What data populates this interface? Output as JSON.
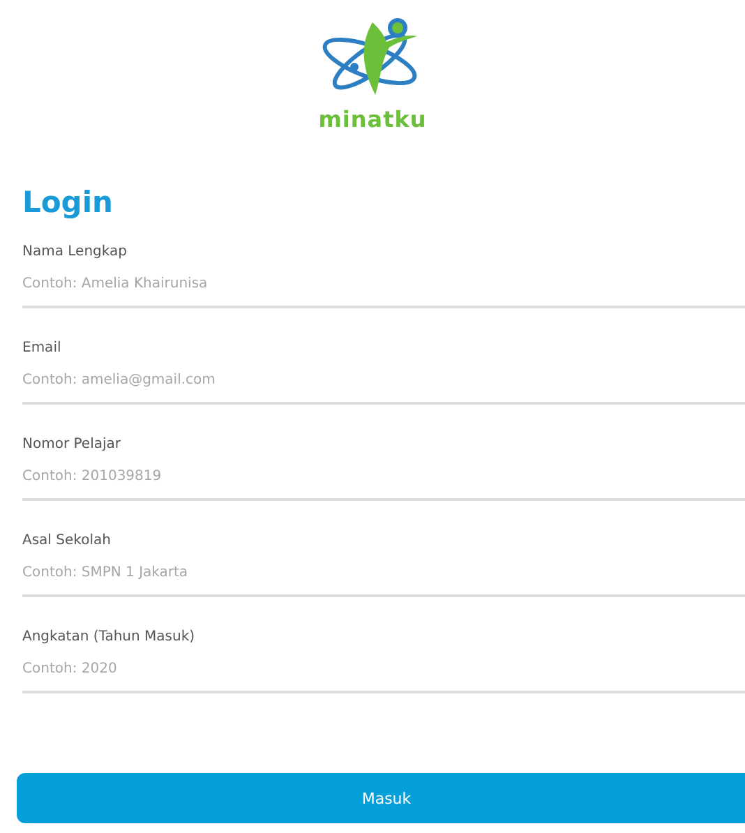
{
  "app": {
    "name": "minatku"
  },
  "title": "Login",
  "fields": [
    {
      "label": "Nama Lengkap",
      "placeholder": "Contoh: Amelia Khairunisa"
    },
    {
      "label": "Email",
      "placeholder": "Contoh: amelia@gmail.com"
    },
    {
      "label": "Nomor Pelajar",
      "placeholder": "Contoh: 201039819"
    },
    {
      "label": "Asal Sekolah",
      "placeholder": "Contoh: SMPN 1 Jakarta"
    },
    {
      "label": "Angkatan (Tahun Masuk)",
      "placeholder": "Contoh: 2020"
    }
  ],
  "submit": "Masuk"
}
